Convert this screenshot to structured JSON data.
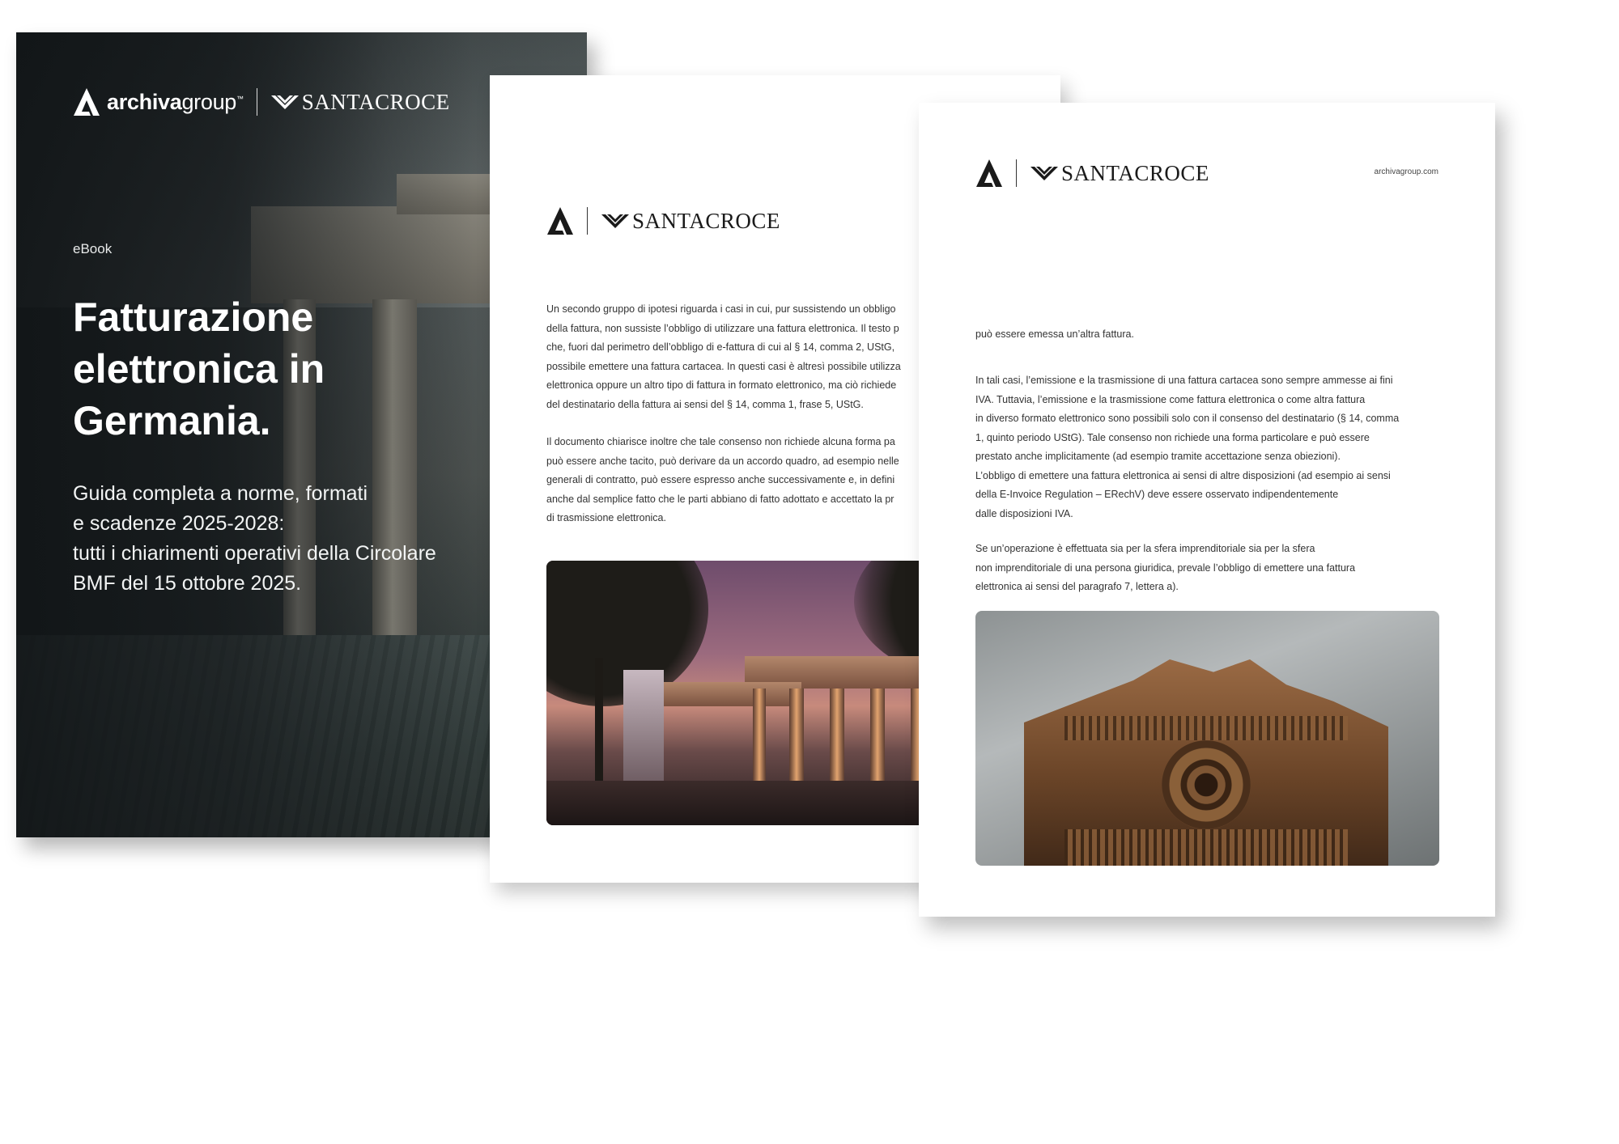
{
  "cover": {
    "brand_primary_bold": "archiva",
    "brand_primary_light": "group",
    "brand_tm": "™",
    "brand_secondary": "SANTACROCE",
    "kicker": "eBook",
    "title": "Fatturazione elettronica in Germania.",
    "subtitle": "Guida completa a norme, formati\ne scadenze 2025-2028:\ntutti i chiarimenti operativi della Circolare\nBMF del 15 ottobre 2025."
  },
  "middle_page": {
    "brand_secondary": "SANTACROCE",
    "paragraph_1": "Un secondo gruppo di ipotesi riguarda i casi in cui, pur sussistendo un obbligo\ndella fattura, non sussiste l’obbligo di utilizzare una fattura elettronica. Il testo p\nche, fuori dal perimetro dell’obbligo di e-fattura di cui al § 14, comma 2, UStG,\npossibile emettere una fattura cartacea. In questi casi è altresì possibile utilizza\nelettronica oppure un altro tipo di fattura in formato elettronico, ma ciò richiede\ndel destinatario della fattura ai sensi del § 14, comma 1, frase 5, UStG.",
    "paragraph_2": "Il documento chiarisce inoltre che tale consenso non richiede alcuna forma pa\npuò essere anche tacito, può derivare da un accordo quadro, ad esempio nelle\ngenerali di contratto, può essere espresso anche successivamente e, in defini\nanche dal semplice fatto che le parti abbiano di fatto adottato e accettato la pr\ndi trasmissione elettronica."
  },
  "front_page": {
    "brand_secondary": "SANTACROCE",
    "site_url": "archivagroup.com",
    "paragraph_1": "può essere emessa un’altra fattura.",
    "paragraph_2": "In tali casi, l’emissione e la trasmissione di una fattura cartacea sono sempre ammesse ai fini\nIVA. Tuttavia, l’emissione e la trasmissione come fattura elettronica o come altra fattura\nin diverso formato elettronico sono possibili solo con il consenso del destinatario (§ 14, comma\n1, quinto periodo UStG). Tale consenso non richiede una forma particolare e può essere\nprestato anche implicitamente (ad esempio tramite accettazione senza obiezioni).\nL’obbligo di emettere una fattura elettronica ai sensi di altre disposizioni (ad esempio ai sensi\ndella E-Invoice Regulation – ERechV) deve essere osservato indipendentemente\ndalle disposizioni IVA.",
    "paragraph_3": "Se un’operazione è effettuata sia per la sfera imprenditoriale sia per la sfera\nnon imprenditoriale di una persona giuridica, prevale l’obbligo di emettere una fattura\nelettronica ai sensi del paragrafo 7, lettera a)."
  },
  "icons": {
    "primary_logo": "archiva-a-logo-icon",
    "secondary_logo": "santacroce-wings-icon"
  },
  "colors": {
    "cover_text": "#ffffff",
    "body_text": "#333333",
    "logo_dark": "#1a1a1a"
  }
}
